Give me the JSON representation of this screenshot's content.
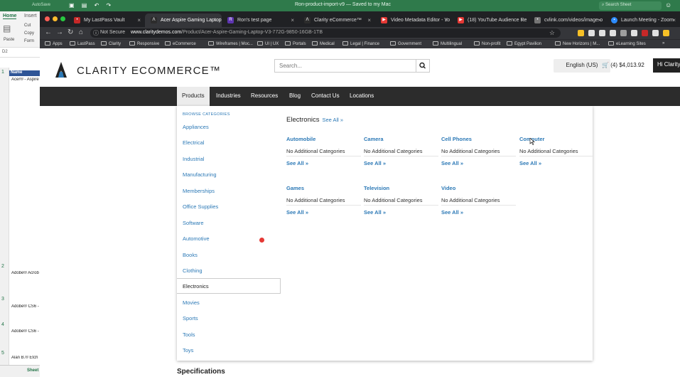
{
  "excel": {
    "autosave": "AutoSave",
    "title": "Ron-product-import-v9 — Saved to my Mac",
    "search_placeholder": "Search Sheet",
    "tabs": [
      "Home",
      "Insert"
    ],
    "ribbon": {
      "paste": "Paste",
      "cut": "Cut",
      "copy": "Copy",
      "format": "Form"
    },
    "name_box": "D2",
    "header_cell": "Name",
    "rows": [
      {
        "num": "1",
        "text": "Acer® - Aspire"
      },
      {
        "num": "2",
        "text": "Adobe® Acrob"
      },
      {
        "num": "3",
        "text": "Adobe® CS6 -"
      },
      {
        "num": "4",
        "text": "Adobe® CS6 -"
      },
      {
        "num": "5",
        "text": "Alan B.® Etch"
      }
    ],
    "sheet_tab": "Sheet"
  },
  "browser": {
    "tabs": [
      {
        "label": "My LastPass Vault",
        "color": "#c62828",
        "icon": "lastpass-icon"
      },
      {
        "label": "Acer Aspire Gaming Laptop",
        "color": "#2c2c2c",
        "icon": "clarity-icon",
        "active": true
      },
      {
        "label": "Ron's test page",
        "color": "#5e35b1",
        "icon": "page-icon"
      },
      {
        "label": "Clarity eCommerce™",
        "color": "#2c2c2c",
        "icon": "clarity-icon"
      },
      {
        "label": "Video Metadata Editor - Yo",
        "color": "#e53935",
        "icon": "youtube-icon"
      },
      {
        "label": "(18) YouTube Audience Re",
        "color": "#e53935",
        "icon": "youtube-icon"
      },
      {
        "label": "cvlink.com/videos/image-o",
        "color": "#757575",
        "icon": "page-icon"
      },
      {
        "label": "Launch Meeting - Zoom",
        "color": "#2d8cff",
        "icon": "zoom-icon"
      }
    ],
    "security": "Not Secure",
    "url_host": "www.claritydemos.com",
    "url_path": "/Product/Acer-Aspire-Gaming-Laptop-V3-772G-9850-16GB-1TB",
    "bookmarks": [
      "Apps",
      "LastPass",
      "Clarity",
      "Responsive",
      "eCommerce",
      "Wireframes | Moc...",
      "UI | UX",
      "Portals",
      "Medical",
      "Legal | Finance",
      "Government",
      "Multilingual",
      "Non-profit",
      "Egypt Pavilion",
      "New Horizons | M...",
      "eLearning Sites"
    ],
    "ext_colors": [
      "#f6c026",
      "#e0e0e0",
      "#e0e0e0",
      "#e0e0e0",
      "#9e9e9e",
      "#e0e0e0",
      "#c62828",
      "#e0e0e0",
      "#f6c026"
    ]
  },
  "site": {
    "logo_text": "CLARITY ECOMMERCE™",
    "search_placeholder": "Search...",
    "language": "English (US)",
    "cart_text": "(4) $4,013.92",
    "greeting": "Hi Clarity",
    "nav": [
      "Products",
      "Industries",
      "Resources",
      "Blog",
      "Contact Us",
      "Locations"
    ],
    "browse_label": "BROWSE CATEGORIES",
    "categories": [
      "Appliances",
      "Electrical",
      "Industrial",
      "Manufacturing",
      "Memberships",
      "Office Supplies",
      "Software",
      "Automotive",
      "Books",
      "Clothing",
      "Electronics",
      "Movies",
      "Sports",
      "Tools",
      "Toys"
    ],
    "active_category": "Electronics",
    "panel_title": "Electronics",
    "see_all": "See All »",
    "subcategories": [
      {
        "name": "Automobile",
        "desc": "No Additional Categories",
        "link": "See All »"
      },
      {
        "name": "Camera",
        "desc": "No Additional Categories",
        "link": "See All »"
      },
      {
        "name": "Cell Phones",
        "desc": "No Additional Categories",
        "link": "See All »"
      },
      {
        "name": "Computer",
        "desc": "No Additional Categories",
        "link": "See All »"
      },
      {
        "name": "Games",
        "desc": "No Additional Categories",
        "link": "See All »"
      },
      {
        "name": "Television",
        "desc": "No Additional Categories",
        "link": "See All »"
      },
      {
        "name": "Video",
        "desc": "No Additional Categories",
        "link": "See All »"
      }
    ],
    "specs_heading": "Specifications"
  }
}
